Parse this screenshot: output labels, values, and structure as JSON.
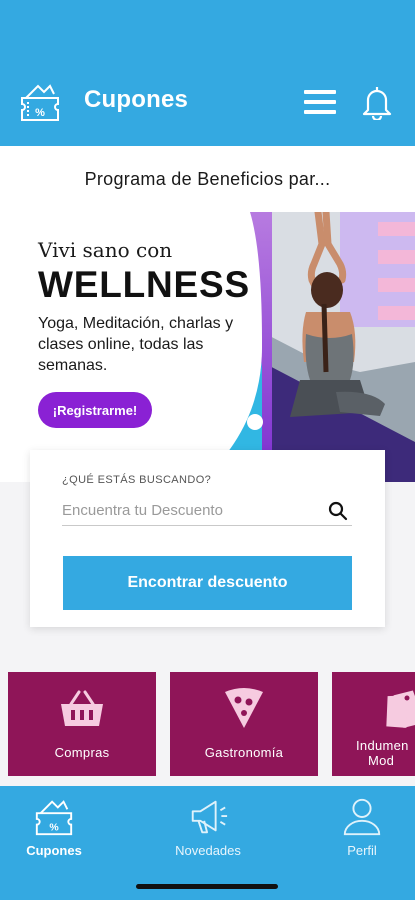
{
  "header": {
    "title": "Cupones",
    "logo_icon": "coupon-ticket-icon",
    "menu_icon": "hamburger-menu-icon",
    "notification_icon": "bell-icon",
    "background_color": "#34a9e1"
  },
  "subheader": {
    "text": "Programa de Beneficios par..."
  },
  "banner": {
    "subtitle": "Vivi sano con",
    "title": "WELLNESS",
    "description": "Yoga, Meditación, charlas y clases online, todas las semanas.",
    "button_label": "¡Registrarme!",
    "accent_color": "#8a21d4",
    "slide_count": 4,
    "active_slide": 4
  },
  "search": {
    "label": "¿QUÉ ESTÁS BUSCANDO?",
    "placeholder": "Encuentra tu Descuento",
    "value": "",
    "search_icon": "magnifier-icon",
    "button_label": "Encontrar descuento"
  },
  "categories": [
    {
      "label": "Compras",
      "icon": "shopping-basket-icon"
    },
    {
      "label": "Gastronomía",
      "icon": "pizza-slice-icon"
    },
    {
      "label": "Indumentaria y Moda",
      "label_line1": "Indumen",
      "label_line2": "Mod",
      "icon": "clothing-tags-icon"
    }
  ],
  "category_color": "#8f1558",
  "bottom_nav": [
    {
      "label": "Cupones",
      "icon": "coupon-ticket-icon",
      "active": true
    },
    {
      "label": "Novedades",
      "icon": "megaphone-icon",
      "active": false
    },
    {
      "label": "Perfil",
      "icon": "user-icon",
      "active": false
    }
  ]
}
